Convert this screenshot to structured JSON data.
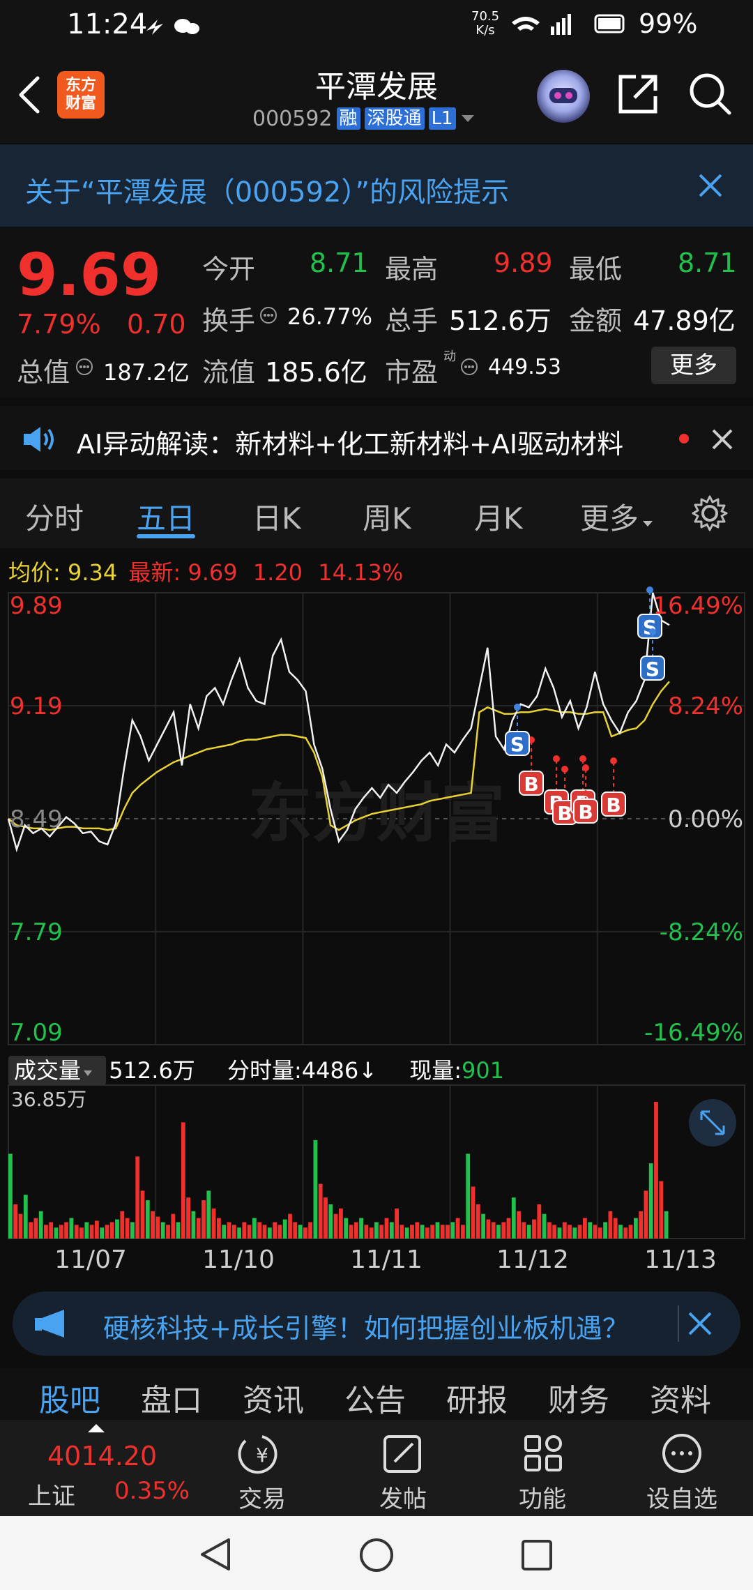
{
  "status_bar": {
    "time": "11:24",
    "net_speed": "70.5",
    "net_unit": "K/s",
    "battery": "99%"
  },
  "header": {
    "logo_text_1": "东方",
    "logo_text_2": "财富",
    "title": "平潭发展",
    "code": "000592",
    "tag_rong": "融",
    "tag_sgt": "深股通",
    "tag_l1": "L1"
  },
  "risk_banner": {
    "text": "关于“平潭发展（000592）”的风险提示"
  },
  "quote": {
    "price": "9.69",
    "change_pct": "7.79%",
    "change_amt": "0.70",
    "open_label": "今开",
    "open": "8.71",
    "high_label": "最高",
    "high": "9.89",
    "low_label": "最低",
    "low": "8.71",
    "turnover_label": "换手",
    "turnover": "26.77%",
    "volume_label": "总手",
    "volume": "512.6万",
    "amount_label": "金额",
    "amount": "47.89亿",
    "mktcap_label": "总值",
    "mktcap": "187.2亿",
    "float_label": "流值",
    "float": "185.6亿",
    "pe_label": "市盈",
    "pe_sup": "动",
    "pe": "449.53",
    "more": "更多"
  },
  "ai_line": {
    "text": "AI异动解读：新材料+化工新材料+AI驱动材料"
  },
  "tabs": [
    "分时",
    "五日",
    "日K",
    "周K",
    "月K",
    "更多"
  ],
  "active_tab": "五日",
  "info_line": {
    "avg_label": "均价:",
    "avg": "9.34",
    "latest_label": "最新:",
    "latest": "9.69",
    "chg": "1.20",
    "chg_pct": "14.13%"
  },
  "chart_data": {
    "type": "line",
    "price_axis": [
      "9.89",
      "9.19",
      "8.49",
      "7.79",
      "7.09"
    ],
    "pct_axis": [
      "16.49%",
      "8.24%",
      "0.00%",
      "-8.24%",
      "-16.49%"
    ],
    "ylim": [
      7.09,
      9.89
    ],
    "x_dates": [
      "11/07",
      "11/10",
      "11/11",
      "11/12",
      "11/13"
    ],
    "watermark": "东方财富",
    "series": [
      {
        "values": [
          8.49,
          8.3,
          8.45,
          8.4,
          8.43,
          8.38,
          8.44,
          8.5,
          8.46,
          8.4,
          8.41,
          8.35,
          8.33,
          8.46,
          8.8,
          9.1,
          9.0,
          8.85,
          8.95,
          9.05,
          9.15,
          8.82,
          9.2,
          9.05,
          9.25,
          9.3,
          9.2,
          9.35,
          9.48,
          9.3,
          9.22,
          9.2,
          9.5,
          9.6,
          9.4,
          9.35,
          9.28,
          8.95,
          8.8,
          8.55,
          8.35,
          8.42,
          8.55,
          8.62,
          8.68,
          8.62,
          8.7,
          8.65,
          8.72,
          8.78,
          8.85,
          8.9,
          8.82,
          8.95,
          8.9,
          8.98,
          9.05,
          9.3,
          9.55,
          9.0,
          8.92,
          9.1,
          9.2,
          9.18,
          9.25,
          9.42,
          9.3,
          9.12,
          9.22,
          9.05,
          9.18,
          9.4,
          9.2,
          9.1,
          9.02,
          9.15,
          9.22,
          9.35,
          9.89,
          9.72,
          9.69
        ]
      },
      {
        "values": [
          8.49,
          8.45,
          8.44,
          8.43,
          8.43,
          8.42,
          8.43,
          8.44,
          8.44,
          8.43,
          8.43,
          8.43,
          8.42,
          8.43,
          8.55,
          8.65,
          8.7,
          8.74,
          8.78,
          8.81,
          8.84,
          8.86,
          8.88,
          8.9,
          8.92,
          8.93,
          8.94,
          8.95,
          8.97,
          8.98,
          8.98,
          8.99,
          9.0,
          9.01,
          9.01,
          9.0,
          8.99,
          8.9,
          8.75,
          8.45,
          8.42,
          8.45,
          8.48,
          8.5,
          8.52,
          8.53,
          8.54,
          8.55,
          8.56,
          8.57,
          8.58,
          8.6,
          8.61,
          8.62,
          8.63,
          8.64,
          8.65,
          9.15,
          9.18,
          9.16,
          9.14,
          9.14,
          9.15,
          9.15,
          9.16,
          9.17,
          9.16,
          9.15,
          9.15,
          9.14,
          9.14,
          9.15,
          9.15,
          9.0,
          9.02,
          9.04,
          9.05,
          9.1,
          9.2,
          9.28,
          9.34
        ]
      }
    ],
    "buy_marks": 6,
    "sell_marks": 3
  },
  "volume": {
    "label": "成交量",
    "total": "512.6万",
    "minute_label": "分时量:",
    "minute": "4486",
    "now_label": "现量:",
    "now": "901",
    "max": "36.85万",
    "values": [
      0.62,
      0.25,
      0.18,
      0.32,
      0.12,
      0.15,
      0.2,
      0.1,
      0.12,
      0.08,
      0.1,
      0.12,
      0.15,
      0.1,
      0.08,
      0.12,
      0.1,
      0.13,
      0.08,
      0.1,
      0.12,
      0.14,
      0.2,
      0.15,
      0.12,
      0.6,
      0.35,
      0.28,
      0.2,
      0.16,
      0.12,
      0.1,
      0.18,
      0.12,
      0.85,
      0.3,
      0.2,
      0.15,
      0.28,
      0.35,
      0.22,
      0.15,
      0.1,
      0.12,
      0.1,
      0.08,
      0.12,
      0.1,
      0.15,
      0.12,
      0.1,
      0.08,
      0.12,
      0.1,
      0.14,
      0.18,
      0.12,
      0.1,
      0.08,
      0.12,
      0.72,
      0.4,
      0.3,
      0.25,
      0.18,
      0.22,
      0.15,
      0.1,
      0.12,
      0.15,
      0.1,
      0.08,
      0.12,
      0.1,
      0.15,
      0.12,
      0.22,
      0.1,
      0.08,
      0.1,
      0.12,
      0.1,
      0.08,
      0.1,
      0.12,
      0.1,
      0.1,
      0.12,
      0.15,
      0.1,
      0.62,
      0.38,
      0.25,
      0.18,
      0.14,
      0.12,
      0.1,
      0.12,
      0.15,
      0.3,
      0.2,
      0.12,
      0.1,
      0.14,
      0.25,
      0.18,
      0.12,
      0.1,
      0.08,
      0.12,
      0.1,
      0.08,
      0.1,
      0.15,
      0.12,
      0.1,
      0.08,
      0.12,
      0.2,
      0.15,
      0.1,
      0.08,
      0.1,
      0.15,
      0.2,
      0.35,
      0.55,
      1.0,
      0.42,
      0.2
    ]
  },
  "ad_banner": {
    "text": "硬核科技+成长引擎！如何把握创业板机遇？"
  },
  "sub_tabs": [
    "股吧",
    "盘口",
    "资讯",
    "公告",
    "研报",
    "财务",
    "资料"
  ],
  "active_sub_tab": "股吧",
  "toolbar": {
    "index_value": "4014.20",
    "index_name": "上证",
    "index_pct": "0.35%",
    "trade": "交易",
    "post": "发帖",
    "function": "功能",
    "watchlist": "设自选"
  },
  "colors": {
    "up": "#f0302c",
    "down": "#22c14d",
    "accent": "#4aa3f0",
    "avg_line": "#e8d234"
  }
}
